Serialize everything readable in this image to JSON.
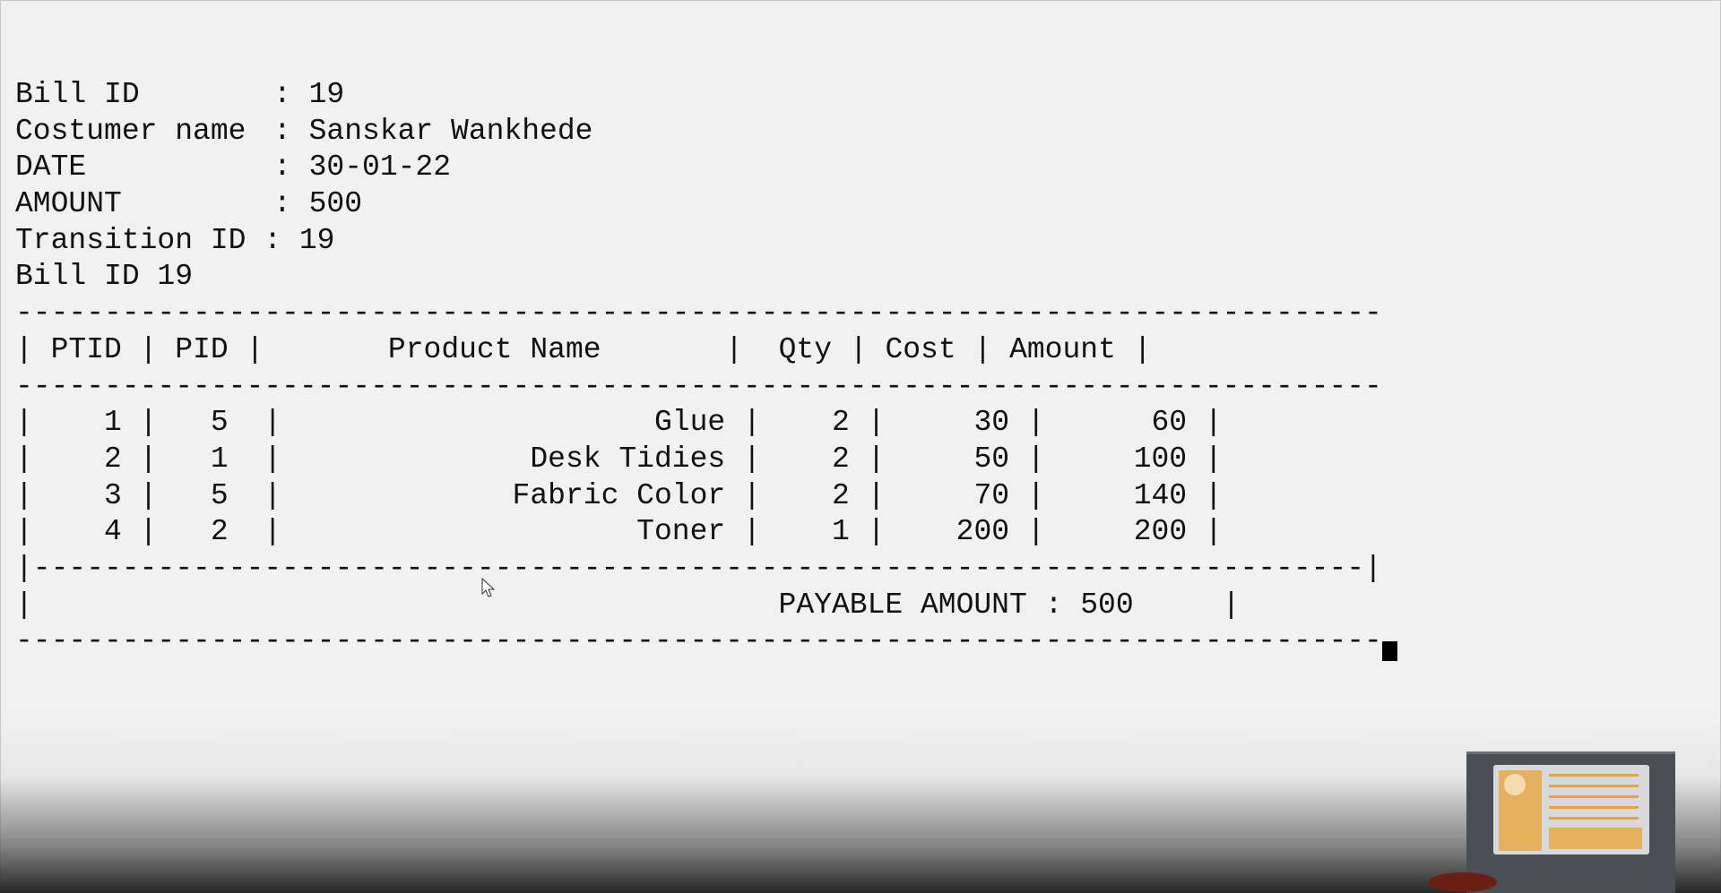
{
  "bill": {
    "bill_id_label": "Bill ID",
    "bill_id_value": "19",
    "customer_label": "Costumer name",
    "customer_value": "Sanskar Wankhede",
    "date_label": "DATE",
    "date_value": "30-01-22",
    "amount_label": "AMOUNT",
    "amount_value": "500",
    "transition_line": "Transition ID : 19",
    "bill_id_line": "Bill ID 19",
    "separator": " : "
  },
  "table": {
    "columns": [
      "PTID",
      "PID",
      "Product Name",
      "Qty",
      "Cost",
      "Amount"
    ],
    "rows": [
      {
        "ptid": "1",
        "pid": "5",
        "product": "Glue",
        "qty": "2",
        "cost": "30",
        "amount": "60"
      },
      {
        "ptid": "2",
        "pid": "1",
        "product": "Desk Tidies",
        "qty": "2",
        "cost": "50",
        "amount": "100"
      },
      {
        "ptid": "3",
        "pid": "5",
        "product": "Fabric Color",
        "qty": "2",
        "cost": "70",
        "amount": "140"
      },
      {
        "ptid": "4",
        "pid": "2",
        "product": "Toner",
        "qty": "1",
        "cost": "200",
        "amount": "200"
      }
    ],
    "payable_label": "PAYABLE AMOUNT",
    "payable_value": "500"
  }
}
